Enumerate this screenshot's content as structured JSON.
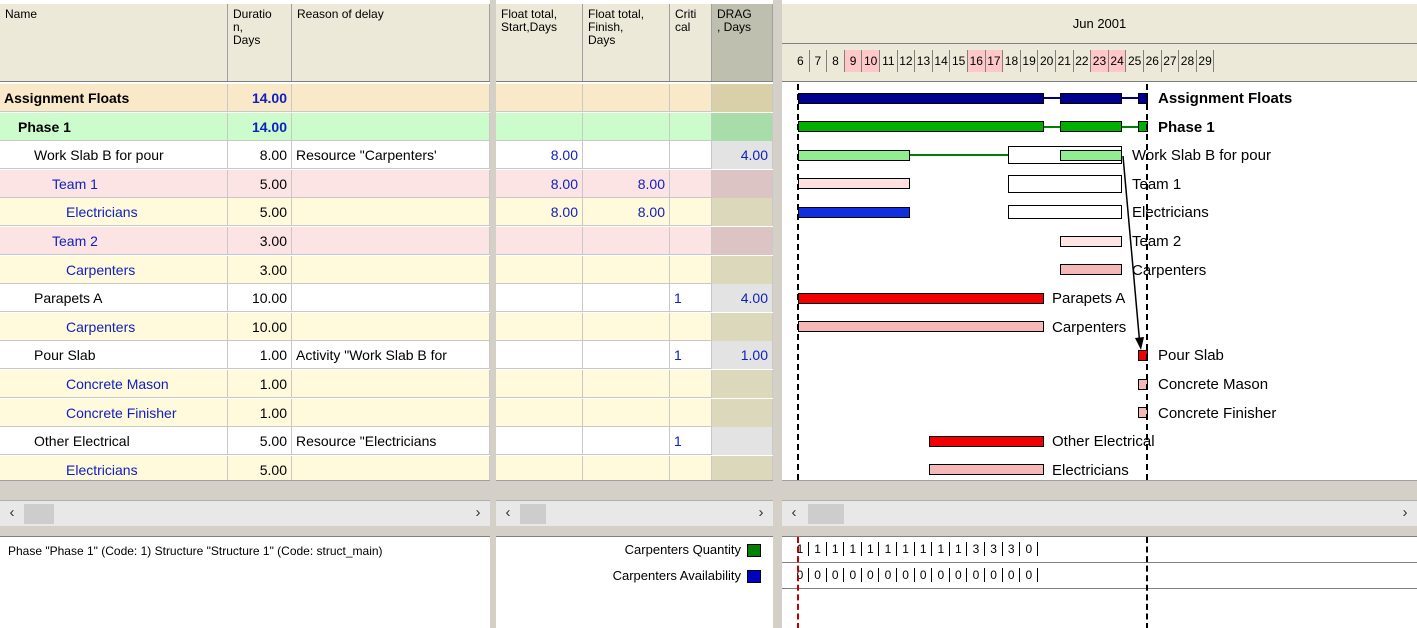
{
  "columns": {
    "name": "Name",
    "duration": "Duratio\nn,\nDays",
    "reason": "Reason of delay",
    "float_start": "Float total,\nStart,Days",
    "float_finish": "Float total,\nFinish,\nDays",
    "critical": "Criti\ncal",
    "drag": "DRAG\n, Days"
  },
  "rows": [
    {
      "name": "Assignment Floats",
      "duration": "14.00",
      "reason": "",
      "float_start": "",
      "float_finish": "",
      "critical": "",
      "drag": "",
      "bg": "#fae9c8",
      "dragbg": "#d9cfa8"
    },
    {
      "name": "Phase 1",
      "duration": "14.00",
      "reason": "",
      "float_start": "",
      "float_finish": "",
      "critical": "",
      "drag": "",
      "bg": "#ccfccc",
      "dragbg": "#a8dca8"
    },
    {
      "name": "Work Slab B for pour",
      "duration": "8.00",
      "reason": "Resource \"Carpenters'",
      "float_start": "8.00",
      "float_finish": "",
      "critical": "",
      "drag": "4.00",
      "bg": "#ffffff",
      "dragbg": "#e3e3e3"
    },
    {
      "name": "Team 1",
      "duration": "5.00",
      "reason": "",
      "float_start": "8.00",
      "float_finish": "8.00",
      "critical": "",
      "drag": "",
      "bg": "#fde4e4",
      "dragbg": "#dcc4c4"
    },
    {
      "name": "Electricians",
      "duration": "5.00",
      "reason": "",
      "float_start": "8.00",
      "float_finish": "8.00",
      "critical": "",
      "drag": "",
      "bg": "#fffadc",
      "dragbg": "#dcd8bc"
    },
    {
      "name": "Team 2",
      "duration": "3.00",
      "reason": "",
      "float_start": "",
      "float_finish": "",
      "critical": "",
      "drag": "",
      "bg": "#fde4e4",
      "dragbg": "#dcc4c4"
    },
    {
      "name": "Carpenters",
      "duration": "3.00",
      "reason": "",
      "float_start": "",
      "float_finish": "",
      "critical": "",
      "drag": "",
      "bg": "#fffadc",
      "dragbg": "#dcd8bc"
    },
    {
      "name": "Parapets A",
      "duration": "10.00",
      "reason": "",
      "float_start": "",
      "float_finish": "",
      "critical": "1",
      "drag": "4.00",
      "bg": "#ffffff",
      "dragbg": "#e3e3e3"
    },
    {
      "name": "Carpenters",
      "duration": "10.00",
      "reason": "",
      "float_start": "",
      "float_finish": "",
      "critical": "",
      "drag": "",
      "bg": "#fffadc",
      "dragbg": "#dcd8bc"
    },
    {
      "name": "Pour Slab",
      "duration": "1.00",
      "reason": "Activity \"Work Slab B for",
      "float_start": "",
      "float_finish": "",
      "critical": "1",
      "drag": "1.00",
      "bg": "#ffffff",
      "dragbg": "#e3e3e3"
    },
    {
      "name": "Concrete Mason",
      "duration": "1.00",
      "reason": "",
      "float_start": "",
      "float_finish": "",
      "critical": "",
      "drag": "",
      "bg": "#fffadc",
      "dragbg": "#dcd8bc"
    },
    {
      "name": "Concrete Finisher",
      "duration": "1.00",
      "reason": "",
      "float_start": "",
      "float_finish": "",
      "critical": "",
      "drag": "",
      "bg": "#fffadc",
      "dragbg": "#dcd8bc"
    },
    {
      "name": "Other Electrical",
      "duration": "5.00",
      "reason": "Resource \"Electricians",
      "float_start": "",
      "float_finish": "",
      "critical": "1",
      "drag": "",
      "bg": "#ffffff",
      "dragbg": "#e3e3e3"
    },
    {
      "name": "Electricians",
      "duration": "5.00",
      "reason": "",
      "float_start": "",
      "float_finish": "",
      "critical": "",
      "drag": "",
      "bg": "#fffadc",
      "dragbg": "#dcd8bc"
    }
  ],
  "gantt": {
    "month": "Jun 2001",
    "days": [
      "6",
      "7",
      "8",
      "9",
      "10",
      "11",
      "12",
      "13",
      "14",
      "15",
      "16",
      "17",
      "18",
      "19",
      "20",
      "21",
      "22",
      "23",
      "24",
      "25",
      "26",
      "27",
      "28",
      "29"
    ],
    "weekend_days": [
      "9",
      "10",
      "16",
      "17",
      "23",
      "24"
    ],
    "labels": [
      "Assignment Floats",
      "Phase 1",
      "Work Slab B for pour",
      "Team 1",
      "Electricians",
      "Team 2",
      "Carpenters",
      "Parapets A",
      "Carpenters",
      "Pour Slab",
      "Concrete Mason",
      "Concrete Finisher",
      "Other Electrical",
      "Electricians"
    ]
  },
  "status_text": "Phase \"Phase 1\" (Code: 1) Structure \"Structure 1\" (Code: struct_main)",
  "legend": {
    "quantity": "Carpenters Quantity",
    "availability": "Carpenters Availability",
    "quantity_color": "#008000",
    "availability_color": "#0000c0"
  },
  "histogram": {
    "quantity": [
      "1",
      "1",
      "1",
      "1",
      "1",
      "1",
      "1",
      "1",
      "1",
      "1",
      "3",
      "3",
      "3",
      "0"
    ],
    "availability": [
      "0",
      "0",
      "0",
      "0",
      "0",
      "0",
      "0",
      "0",
      "0",
      "0",
      "0",
      "0",
      "0",
      "0"
    ]
  },
  "icons": {
    "scroll_left": "‹",
    "scroll_right": "›"
  }
}
